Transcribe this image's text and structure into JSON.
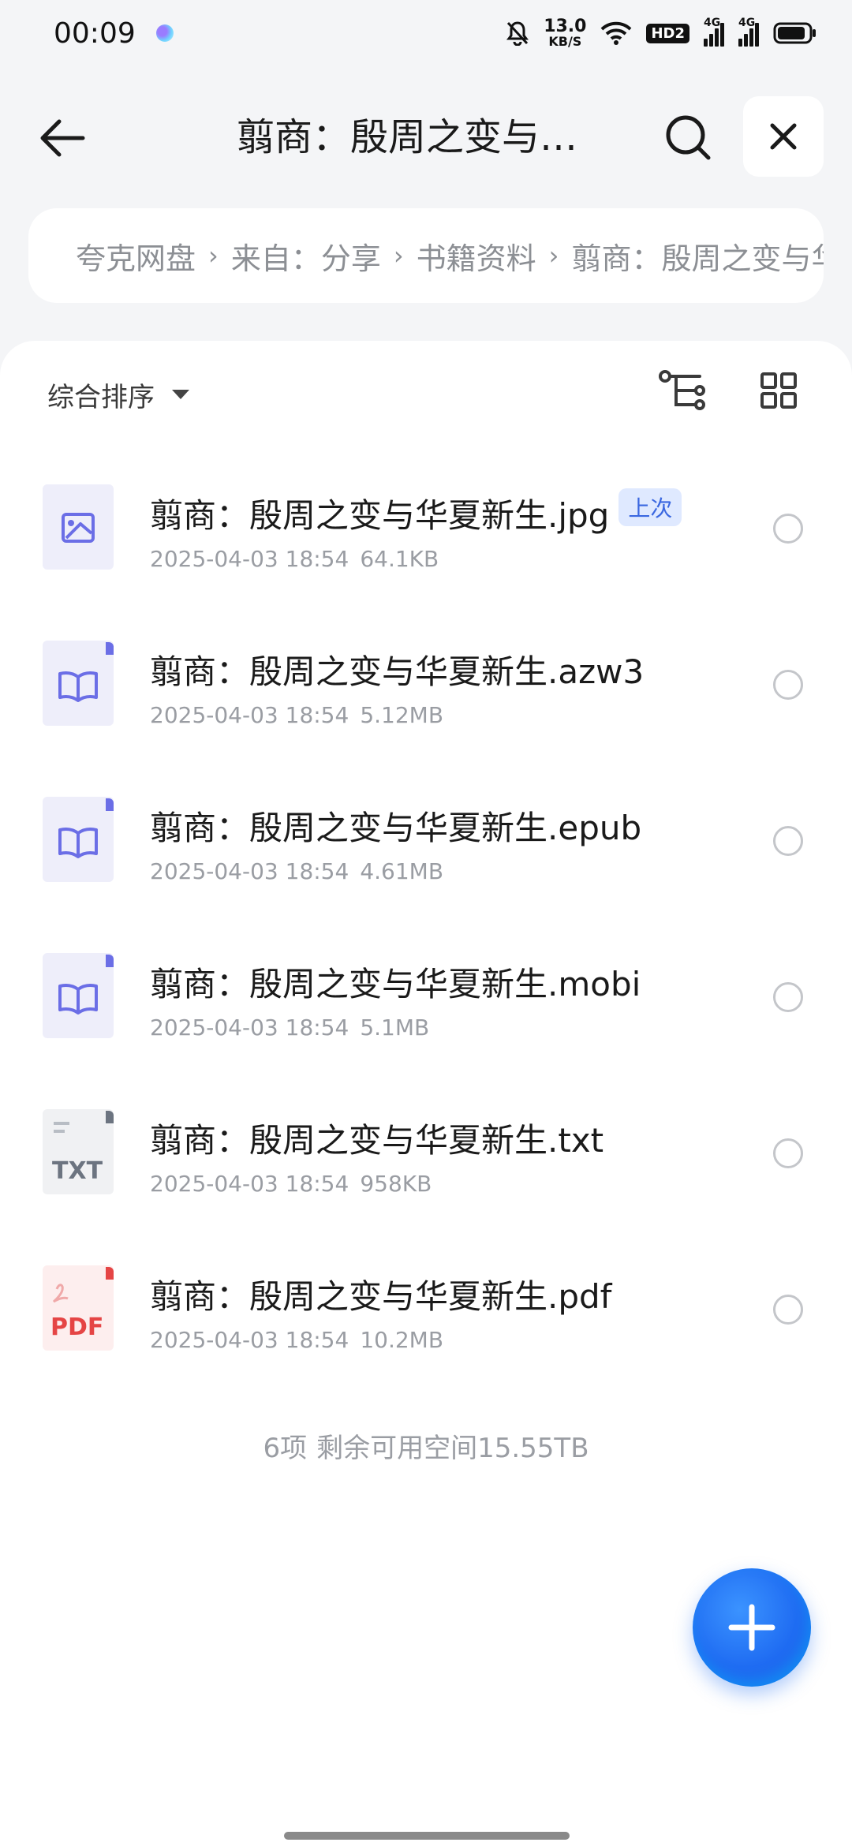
{
  "status_bar": {
    "time": "00:09",
    "net_speed_value": "13.0",
    "net_speed_unit": "KB/S",
    "hd_label": "HD2",
    "sim1_label": "4G",
    "sim2_label": "4G"
  },
  "header": {
    "title": "翦商：殷周之变与华夏新生"
  },
  "breadcrumb": {
    "items": [
      "夸克网盘",
      "来自：分享",
      "书籍资料",
      "翦商：殷周之变与华夏新生"
    ]
  },
  "sort": {
    "label": "综合排序"
  },
  "files": [
    {
      "name": "翦商：殷周之变与华夏新生.jpg",
      "date": "2025-04-03 18:54",
      "size": "64.1KB",
      "icon": "image-file-icon",
      "badge": "上次"
    },
    {
      "name": "翦商：殷周之变与华夏新生.azw3",
      "date": "2025-04-03 18:54",
      "size": "5.12MB",
      "icon": "ebook-file-icon"
    },
    {
      "name": "翦商：殷周之变与华夏新生.epub",
      "date": "2025-04-03 18:54",
      "size": "4.61MB",
      "icon": "ebook-file-icon"
    },
    {
      "name": "翦商：殷周之变与华夏新生.mobi",
      "date": "2025-04-03 18:54",
      "size": "5.1MB",
      "icon": "ebook-file-icon"
    },
    {
      "name": "翦商：殷周之变与华夏新生.txt",
      "date": "2025-04-03 18:54",
      "size": "958KB",
      "icon": "txt-file-icon",
      "icon_text": "TXT"
    },
    {
      "name": "翦商：殷周之变与华夏新生.pdf",
      "date": "2025-04-03 18:54",
      "size": "10.2MB",
      "icon": "pdf-file-icon",
      "icon_text": "PDF"
    }
  ],
  "summary": {
    "count": "6项",
    "space": "剩余可用空间15.55TB"
  },
  "colors": {
    "accent": "#1f6cf2",
    "ebook_icon_bg": "#eeeefa",
    "ebook_icon_fg": "#6b6ee6",
    "pdf_red": "#e54545",
    "txt_gray": "#6c7480"
  }
}
